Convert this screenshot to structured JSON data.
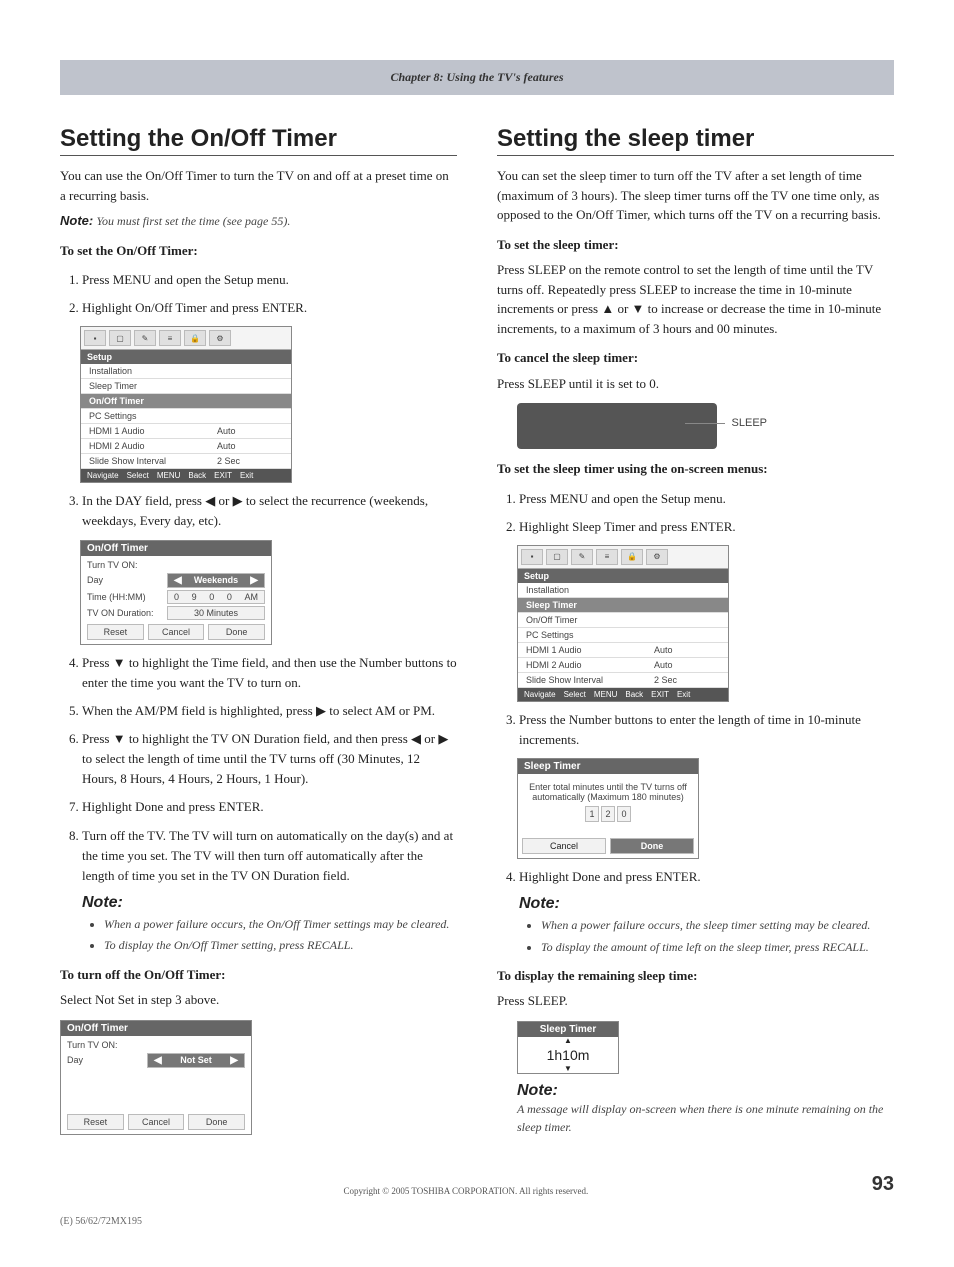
{
  "chapter": "Chapter 8: Using the TV's features",
  "left": {
    "title": "Setting the On/Off Timer",
    "intro": "You can use the On/Off Timer to turn the TV on and off at a preset time on a recurring basis.",
    "note1_label": "Note:",
    "note1": "You must first set the time (see page 55).",
    "lead1": "To set the On/Off Timer:",
    "step1": "Press MENU and open the Setup menu.",
    "step2": "Highlight On/Off Timer and press ENTER.",
    "step3": "In the DAY field, press ◀ or ▶ to select the recurrence (weekends, weekdays, Every day, etc).",
    "step4": "Press ▼ to highlight the Time field, and then use the Number buttons to enter the time you want the TV to turn on.",
    "step5": "When the AM/PM field is highlighted, press ▶ to select AM or PM.",
    "step6": "Press ▼ to highlight the TV ON Duration field, and then press ◀ or ▶ to select the length of time until the TV turns off (30 Minutes, 12 Hours, 8 Hours, 4 Hours, 2 Hours, 1 Hour).",
    "step7": "Highlight Done and press ENTER.",
    "step8": "Turn off the TV. The TV will turn on automatically on the day(s) and at the time you set. The TV will then turn off automatically after the length of time you set in the TV ON Duration field.",
    "note2_label": "Note:",
    "note2a": "When a power failure occurs, the On/Off Timer settings may be cleared.",
    "note2b": "To display the On/Off Timer setting, press RECALL.",
    "lead2": "To turn off the On/Off Timer:",
    "turnoff": "Select Not Set in step 3 above."
  },
  "right": {
    "title": "Setting the sleep timer",
    "intro": "You can set the sleep timer to turn off the TV after a set length of time (maximum of 3 hours). The sleep timer turns off the TV one time only, as opposed to the On/Off Timer, which turns off the TV on a recurring basis.",
    "lead1": "To set the sleep timer:",
    "para1": "Press SLEEP on the remote control to set the length of time until the TV turns off. Repeatedly press SLEEP to increase the time in 10-minute increments or press ▲ or ▼ to increase or decrease the time in 10-minute increments, to a maximum of 3 hours and 00 minutes.",
    "lead2": "To cancel the sleep timer:",
    "para2": "Press SLEEP until it is set to 0.",
    "sleep_label": "SLEEP",
    "lead3": "To set the sleep timer using the on-screen menus:",
    "step1": "Press MENU and open the Setup menu.",
    "step2": "Highlight Sleep Timer and press ENTER.",
    "step3": "Press the Number buttons to enter the length of time in 10-minute increments.",
    "step4": "Highlight Done and press ENTER.",
    "note_label": "Note:",
    "note_a": "When a power failure occurs, the sleep timer setting may be cleared.",
    "note_b": "To display the amount of time left on the sleep timer, press RECALL.",
    "lead4": "To display the remaining sleep time:",
    "para4": "Press SLEEP.",
    "note2_label": "Note:",
    "note2": "A message will display on-screen when there is one minute remaining on the sleep timer."
  },
  "osd": {
    "title": "Setup",
    "installation": "Installation",
    "sleep_timer": "Sleep Timer",
    "onoff_timer": "On/Off Timer",
    "pc_settings": "PC Settings",
    "hdmi1": "HDMI 1 Audio",
    "hdmi2": "HDMI 2 Audio",
    "slide": "Slide Show Interval",
    "auto": "Auto",
    "twosec": "2 Sec",
    "nav": "Navigate",
    "sel": "Select",
    "back": "Back",
    "exit": "Exit",
    "menu": "MENU",
    "exitbtn": "EXIT"
  },
  "onoff_panel": {
    "title": "On/Off Timer",
    "turn_on": "Turn TV ON:",
    "day": "Day",
    "weekends": "Weekends",
    "notset": "Not Set",
    "time": "Time (HH:MM)",
    "time_val_h1": "0",
    "time_val_h2": "9",
    "time_val_m1": "0",
    "time_val_m2": "0",
    "ampm": "AM",
    "duration": "TV ON Duration:",
    "duration_val": "30 Minutes",
    "reset": "Reset",
    "cancel": "Cancel",
    "done": "Done"
  },
  "sleep_panel": {
    "title": "Sleep Timer",
    "msg": "Enter total minutes until the TV turns off automatically (Maximum 180 minutes)",
    "d1": "1",
    "d2": "2",
    "d3": "0",
    "cancel": "Cancel",
    "done": "Done",
    "remaining": "1h10m"
  },
  "footer": {
    "copyright": "Copyright © 2005 TOSHIBA CORPORATION. All rights reserved.",
    "page": "93",
    "model": "(E) 56/62/72MX195"
  }
}
